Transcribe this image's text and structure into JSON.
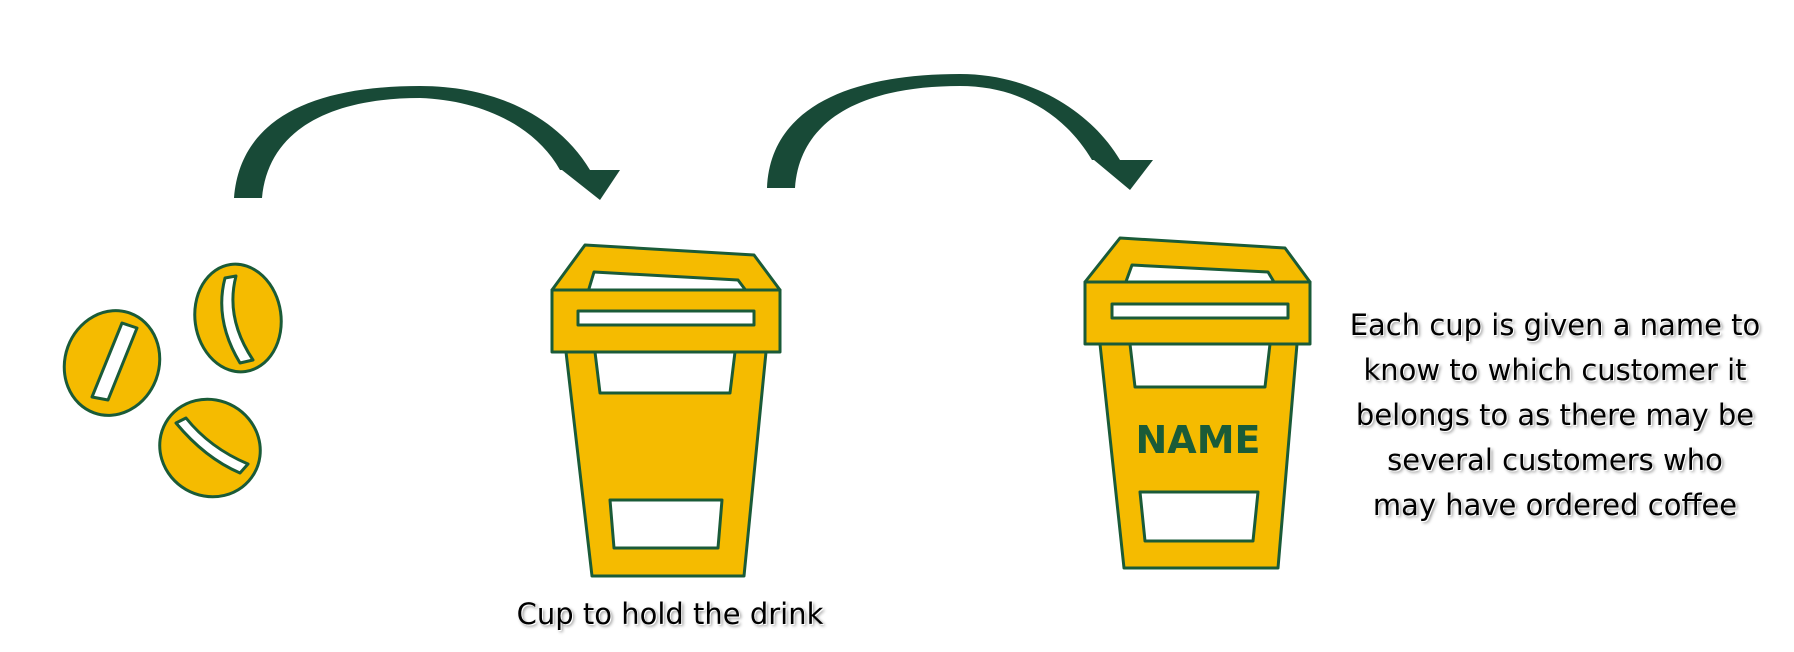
{
  "colors": {
    "cup_fill": "#f5bb00",
    "outline": "#1a5b38",
    "arrow": "#184a37",
    "panel": "#ffffff",
    "name_text": "#1a5b38"
  },
  "icons": {
    "beans": "coffee-bean-icon",
    "arrow": "curved-arrow-icon",
    "cup": "takeaway-cup-icon"
  },
  "labels": {
    "cup_caption": "Cup to hold the drink",
    "name_on_cup": "NAME",
    "note_lines": [
      "Each cup is given a name to",
      "know to which customer it",
      "belongs to as  there may be",
      "several customers who",
      "may have ordered coffee"
    ]
  }
}
